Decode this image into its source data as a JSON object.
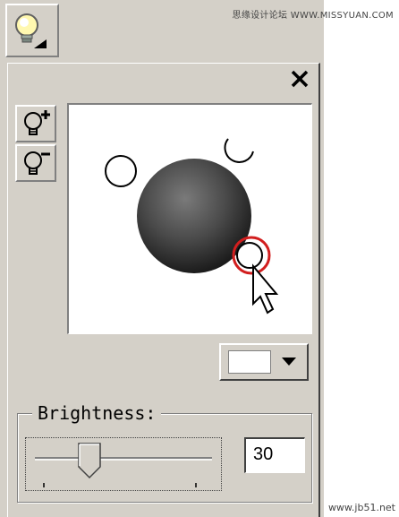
{
  "watermark_top": "思缘设计论坛 WWW.MISSYUAN.COM",
  "watermark_bottom": "www.jb51.net",
  "panel": {
    "close_glyph": "✕",
    "add_light_icon": "lightbulb-plus-icon",
    "remove_light_icon": "lightbulb-minus-icon",
    "color_swatch": "#ffffff",
    "brightness": {
      "label": "Brightness:",
      "value": "30",
      "level_fraction": 0.3
    }
  }
}
